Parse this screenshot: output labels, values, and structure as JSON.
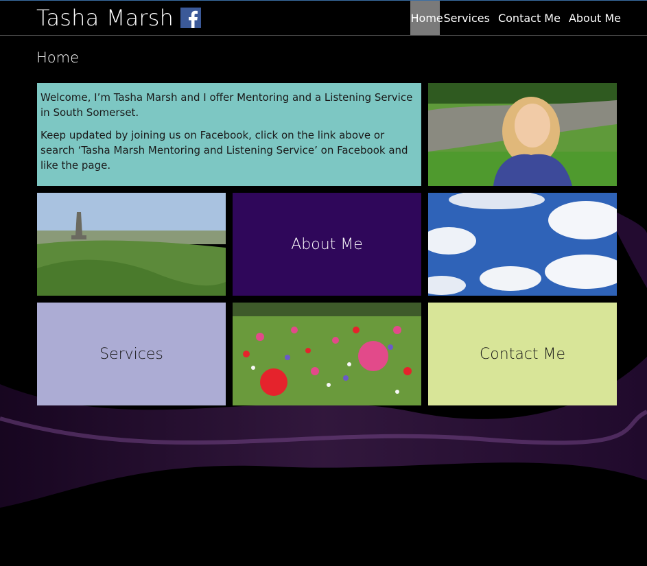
{
  "header": {
    "brand_name": "Tasha Marsh",
    "facebook_icon": "facebook-icon",
    "nav": [
      {
        "label": "Home",
        "active": true
      },
      {
        "label": "Services",
        "active": false
      },
      {
        "label": "Contact Me",
        "active": false
      },
      {
        "label": "About Me",
        "active": false
      }
    ]
  },
  "page": {
    "title": "Home"
  },
  "welcome": {
    "paragraph_1": "Welcome, I’m Tasha Marsh and I offer Mentoring and a Listening Service in South Somerset.",
    "paragraph_2": "Keep updated by joining us on Facebook, click on the link above or search ‘Tasha Marsh Mentoring and Listening Service’ on Facebook and like the page."
  },
  "tiles": {
    "about_label": "About Me",
    "services_label": "Services",
    "contact_label": "Contact Me"
  },
  "colors": {
    "welcome_bg": "#7dc7c3",
    "about_bg": "#2f075a",
    "services_bg": "#acacd4",
    "contact_bg": "#d8e598",
    "nav_active_bg": "#7a7a7a",
    "facebook_blue": "#3b5998"
  }
}
